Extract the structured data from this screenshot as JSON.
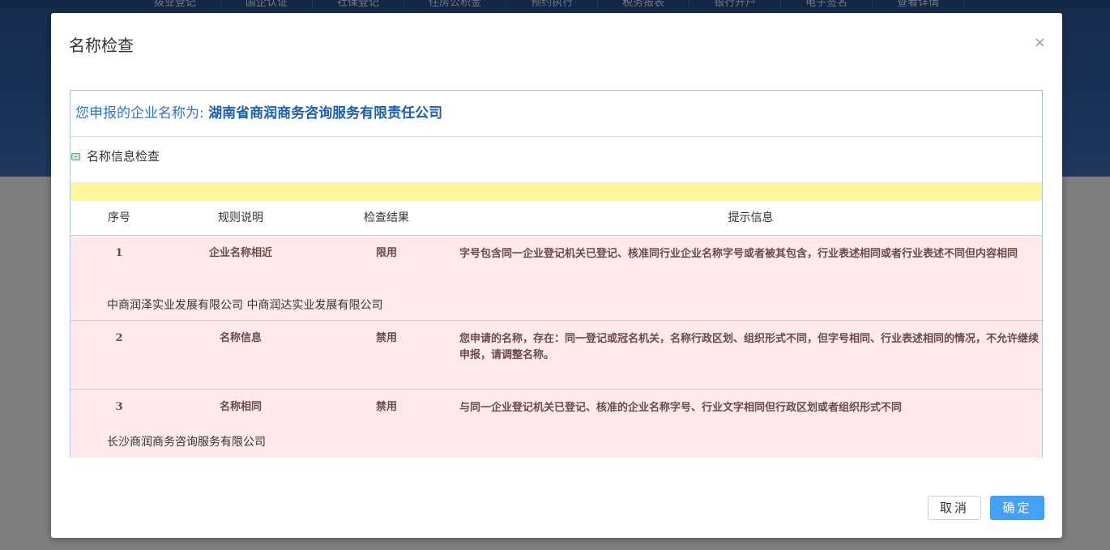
{
  "background": {
    "nav_items": [
      "拨业登记",
      "国企认证",
      "社保登记",
      "住房公积金",
      "预约执行",
      "税务报表",
      "银行开户",
      "电子签名",
      "查看详情"
    ]
  },
  "modal": {
    "title": "名称检查",
    "close_glyph": "×",
    "name_prefix": "您申报的企业名称为: ",
    "company_name": "湖南省商润商务咨询服务有限责任公司",
    "section_title": "名称信息检查",
    "table": {
      "headers": [
        "序号",
        "规则说明",
        "检查结果",
        "提示信息"
      ],
      "rows": [
        {
          "index": "1",
          "rule": "企业名称相近",
          "result": "限用",
          "hint": "字号包含同一企业登记机关已登记、核准同行业企业名称字号或者被其包含，行业表述相同或者行业表述不同但内容相同",
          "related": "中商润泽实业发展有限公司  中商润达实业发展有限公司"
        },
        {
          "index": "2",
          "rule": "名称信息",
          "result": "禁用",
          "hint": "您申请的名称，存在：同一登记或冠名机关，名称行政区划、组织形式不同，但字号相同、行业表述相同的情况，不允许继续申报，请调整名称。",
          "related": ""
        },
        {
          "index": "3",
          "rule": "名称相同",
          "result": "禁用",
          "hint": "与同一企业登记机关已登记、核准的企业名称字号、行业文字相同但行政区划或者组织形式不同",
          "related": "长沙商润商务咨询服务有限公司"
        }
      ]
    },
    "buttons": {
      "cancel": "取消",
      "ok": "确定"
    }
  },
  "colors": {
    "accent": "#45a0f7",
    "name_text": "#2e74c8",
    "row_bg": "#ffe9ea",
    "highlight_bar": "#fff59c"
  }
}
